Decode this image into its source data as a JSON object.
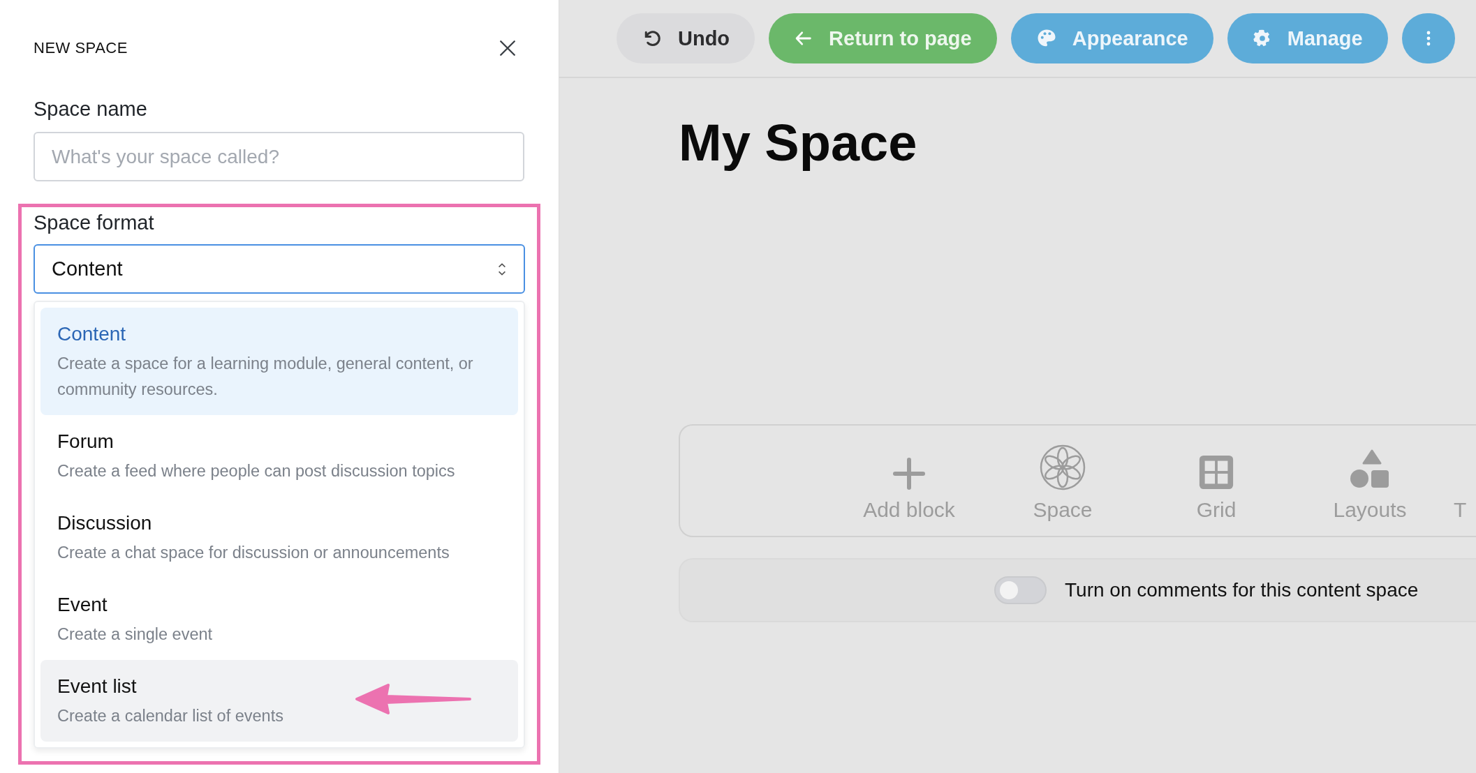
{
  "panel": {
    "title": "NEW SPACE",
    "name_field": {
      "label": "Space name",
      "placeholder": "What's your space called?"
    },
    "format_field": {
      "label": "Space format",
      "value": "Content"
    },
    "options": [
      {
        "title": "Content",
        "description": "Create a space for a learning module, general content, or community resources.",
        "selected": true,
        "highlighted": false
      },
      {
        "title": "Forum",
        "description": "Create a feed where people can post discussion topics",
        "selected": false,
        "highlighted": false
      },
      {
        "title": "Discussion",
        "description": "Create a chat space for discussion or announcements",
        "selected": false,
        "highlighted": false
      },
      {
        "title": "Event",
        "description": "Create a single event",
        "selected": false,
        "highlighted": false
      },
      {
        "title": "Event list",
        "description": "Create a calendar list of events",
        "selected": false,
        "highlighted": true
      }
    ]
  },
  "toolbar": {
    "buttons": [
      {
        "label": "Undo",
        "kind": "undo"
      },
      {
        "label": "Return to page",
        "kind": "return"
      },
      {
        "label": "Appearance",
        "kind": "appearance"
      },
      {
        "label": "Manage",
        "kind": "manage"
      },
      {
        "kind": "more"
      }
    ]
  },
  "page": {
    "title": "My Space",
    "blocks": [
      {
        "label": "Add block",
        "kind": "add"
      },
      {
        "label": "Space",
        "kind": "space"
      },
      {
        "label": "Grid",
        "kind": "grid"
      },
      {
        "label": "Layouts",
        "kind": "layouts"
      },
      {
        "label": "T",
        "kind": "cut"
      }
    ],
    "comments": {
      "label": "Turn on comments for this content space",
      "on": false
    }
  }
}
